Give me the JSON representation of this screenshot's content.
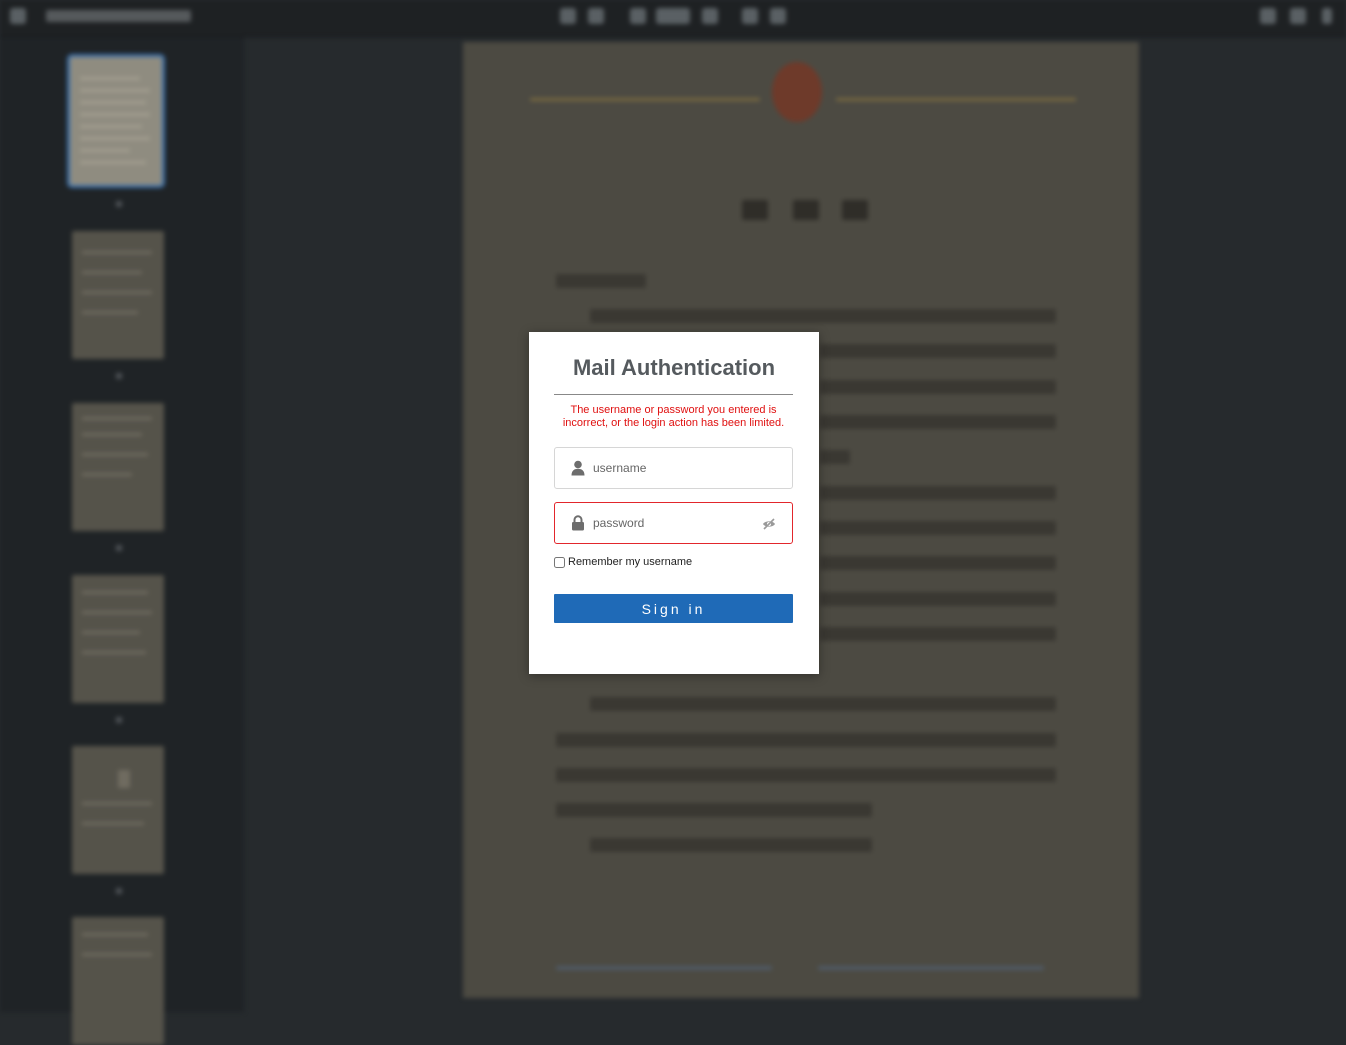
{
  "login": {
    "title": "Mail Authentication",
    "error_message": "The username or password you entered is incorrect, or the login action has been limited.",
    "username_placeholder": "username",
    "username_value": "",
    "password_placeholder": "password",
    "password_value": "",
    "remember_label": "Remember my username",
    "remember_checked": false,
    "signin_label": "Sign in",
    "error_color": "#e01010",
    "button_color": "#1f6ab7"
  },
  "icons": {
    "user": "user-icon",
    "lock": "lock-icon",
    "toggle_password": "eye-slash-icon"
  }
}
